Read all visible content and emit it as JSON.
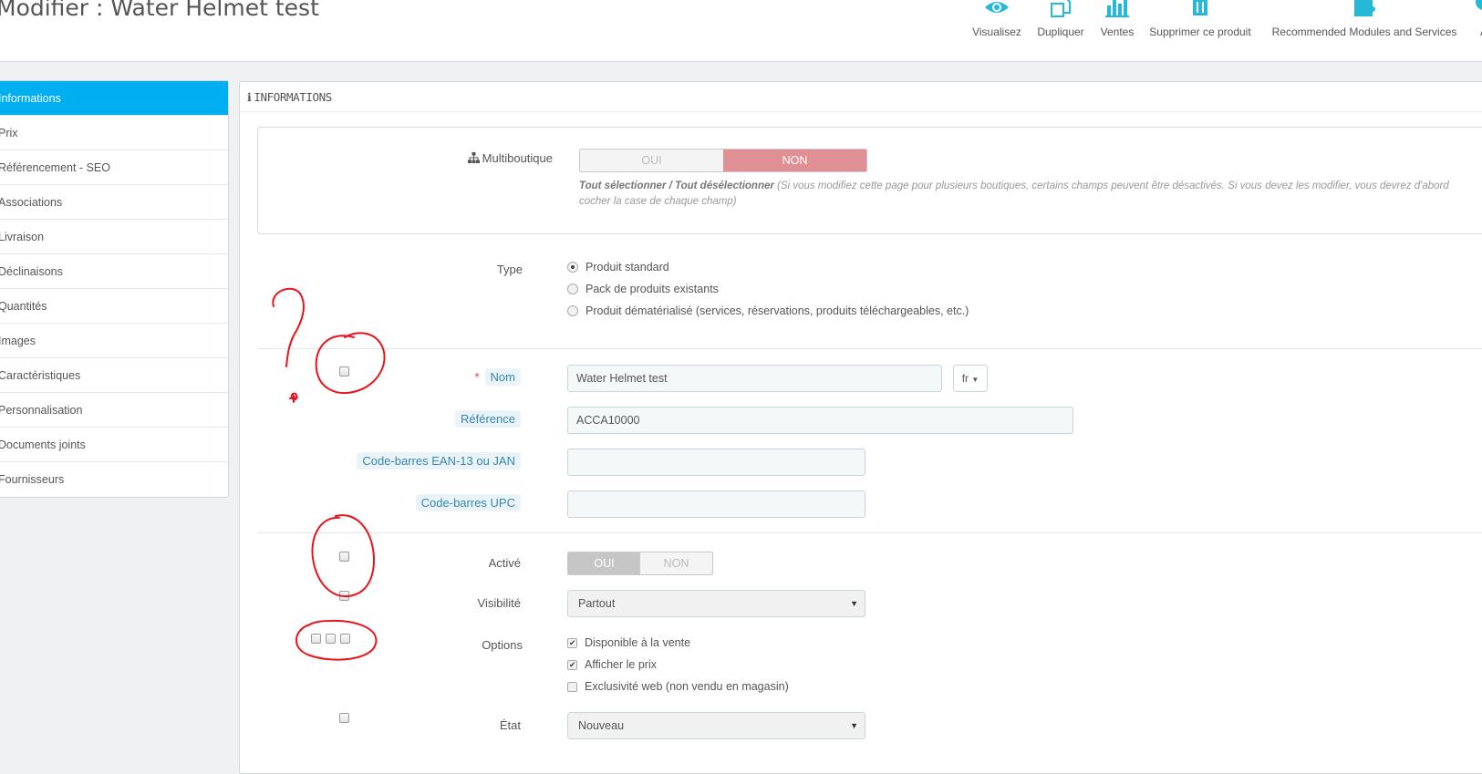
{
  "header": {
    "title": "Modifier : Water Helmet test",
    "toolbar": [
      {
        "label": "Visualisez",
        "icon": "eye-icon"
      },
      {
        "label": "Dupliquer",
        "icon": "copy-icon"
      },
      {
        "label": "Ventes",
        "icon": "bar-chart-icon"
      },
      {
        "label": "Supprimer ce produit",
        "icon": "trash-icon"
      },
      {
        "label": "Recommended Modules and Services",
        "icon": "puzzle-icon"
      },
      {
        "label": "A",
        "icon": "help-icon"
      }
    ]
  },
  "sidebar": {
    "items": [
      {
        "label": "Informations",
        "active": true
      },
      {
        "label": "Prix"
      },
      {
        "label": "Référencement - SEO"
      },
      {
        "label": "Associations"
      },
      {
        "label": "Livraison"
      },
      {
        "label": "Déclinaisons"
      },
      {
        "label": "Quantités"
      },
      {
        "label": "Images"
      },
      {
        "label": "Caractéristiques"
      },
      {
        "label": "Personnalisation"
      },
      {
        "label": "Documents joints"
      },
      {
        "label": "Fournisseurs"
      }
    ]
  },
  "panel": {
    "heading_icon": "i",
    "heading": "INFORMATIONS",
    "multishop": {
      "label": "Multiboutique",
      "yes": "OUI",
      "no": "NON",
      "help_bold": "Tout sélectionner / Tout désélectionner",
      "help_text": " (Si vous modifiez cette page pour plusieurs boutiques, certains champs peuvent être désactivés. Si vous devez les modifier, vous devrez d'abord cocher la case de chaque champ)"
    },
    "type": {
      "label": "Type",
      "options": [
        {
          "label": "Produit standard",
          "checked": true
        },
        {
          "label": "Pack de produits existants",
          "checked": false
        },
        {
          "label": "Produit dématérialisé (services, réservations, produits téléchargeables, etc.)",
          "checked": false
        }
      ]
    },
    "name": {
      "required_mark": "*",
      "label": "Nom",
      "value": "Water Helmet test",
      "lang": "fr"
    },
    "reference": {
      "label": "Référence",
      "value": "ACCA10000"
    },
    "ean13": {
      "label": "Code-barres EAN-13 ou JAN",
      "value": ""
    },
    "upc": {
      "label": "Code-barres UPC",
      "value": ""
    },
    "active": {
      "label": "Activé",
      "yes": "OUI",
      "no": "NON"
    },
    "visibility": {
      "label": "Visibilité",
      "value": "Partout"
    },
    "options": {
      "label": "Options",
      "items": [
        {
          "label": "Disponible à la vente",
          "checked": true
        },
        {
          "label": "Afficher le prix",
          "checked": true
        },
        {
          "label": "Exclusivité web (non vendu en magasin)",
          "checked": false
        }
      ]
    },
    "condition": {
      "label": "État",
      "value": "Nouveau"
    }
  },
  "colors": {
    "accent": "#00aff0",
    "switch_no": "#e08f95",
    "annotation": "#e8141b"
  }
}
